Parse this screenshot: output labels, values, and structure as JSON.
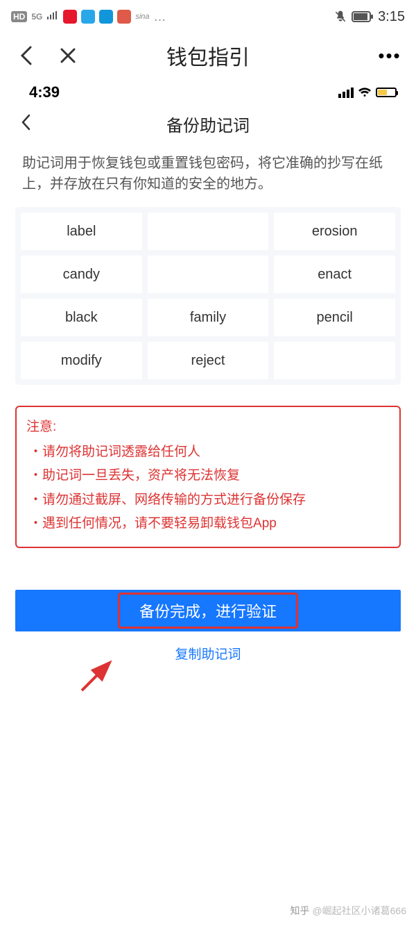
{
  "outer_status": {
    "hd": "HD",
    "net": "5G",
    "time": "3:15"
  },
  "outer_nav": {
    "title": "钱包指引"
  },
  "inner_status": {
    "time": "4:39"
  },
  "inner_nav": {
    "title": "备份助记词"
  },
  "desc": "助记词用于恢复钱包或重置钱包密码，将它准确的抄写在纸上，并存放在只有你知道的安全的地方。",
  "words": [
    "label",
    "",
    "erosion",
    "candy",
    "",
    "enact",
    "black",
    "family",
    "pencil",
    "modify",
    "reject",
    ""
  ],
  "notice": {
    "title": "注意:",
    "items": [
      "请勿将助记词透露给任何人",
      "助记词一旦丢失，资产将无法恢复",
      "请勿通过截屏、网络传输的方式进行备份保存",
      "遇到任何情况，请不要轻易卸载钱包App"
    ]
  },
  "primary_button": "备份完成，进行验证",
  "copy_link": "复制助记词",
  "watermark": {
    "brand": "知乎",
    "author": "@崛起社区小诸葛666"
  }
}
